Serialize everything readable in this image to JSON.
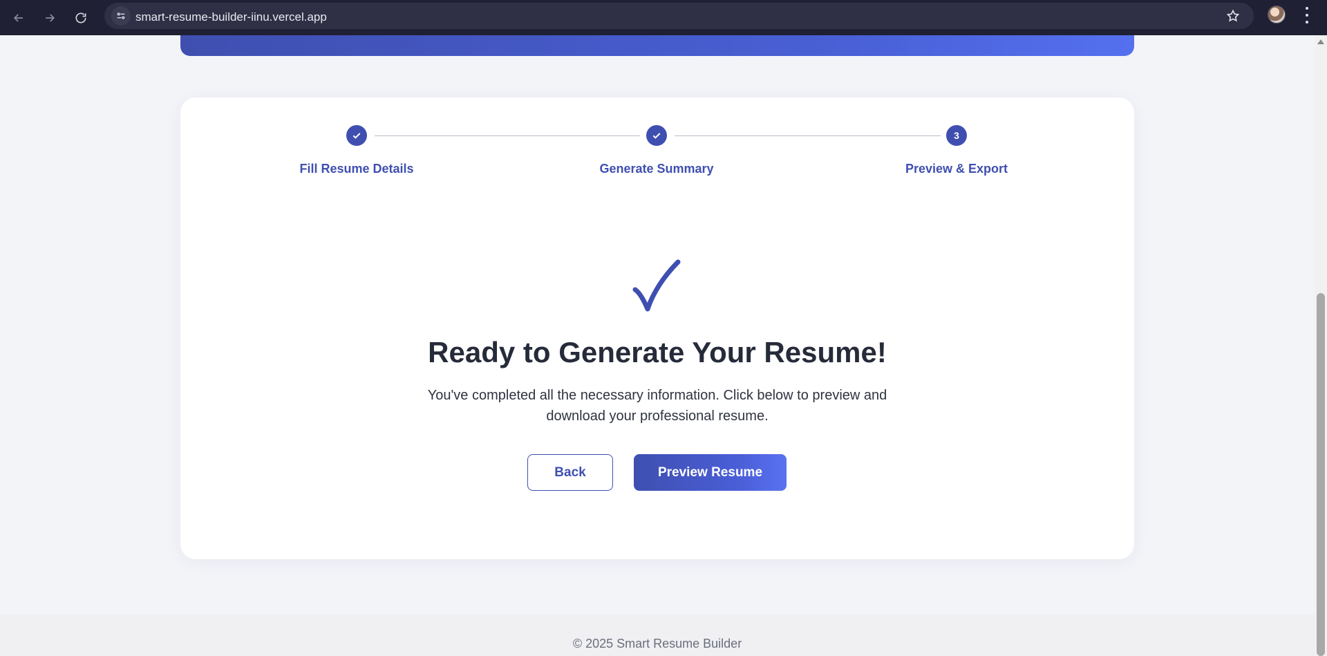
{
  "browser": {
    "url": "smart-resume-builder-iinu.vercel.app"
  },
  "stepper": {
    "steps": [
      {
        "label": "Fill Resume Details",
        "status": "completed"
      },
      {
        "label": "Generate Summary",
        "status": "completed"
      },
      {
        "label": "Preview & Export",
        "status": "current",
        "number": "3"
      }
    ]
  },
  "main": {
    "icon": "check-mark-icon",
    "title": "Ready to Generate Your Resume!",
    "description": "You've completed all the necessary information. Click below to preview and download your professional resume.",
    "back_label": "Back",
    "preview_label": "Preview Resume"
  },
  "footer": {
    "text": "© 2025 Smart Resume Builder"
  },
  "colors": {
    "accent": "#3f4fb0",
    "accent_light": "#5a72f0",
    "heading": "#262b3a"
  }
}
